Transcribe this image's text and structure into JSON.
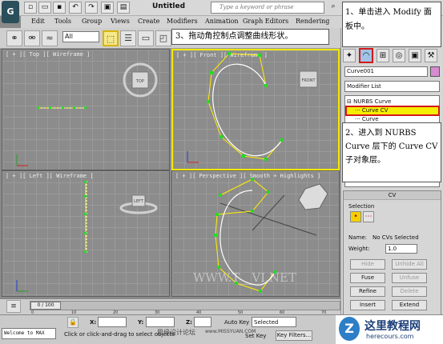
{
  "window": {
    "doc_title": "Untitled",
    "search_placeholder": "Type a keyword or phrase"
  },
  "menu": [
    "Edit",
    "Tools",
    "Group",
    "Views",
    "Create",
    "Modifiers",
    "Animation",
    "Graph Editors",
    "Rendering"
  ],
  "toolbar": {
    "selection_filter": "All"
  },
  "viewports": {
    "top_label": "[ + ][ Top ][ Wireframe ]",
    "front_label": "[ + ][ Front ][ Wireframe ]",
    "left_label": "[ + ][ Left ][ Wireframe ]",
    "perspective_label": "[ + ][ Perspective ][ Smooth + Highlights ]",
    "cube_top": "TOP",
    "cube_front": "FRONT",
    "cube_left": "LEFT"
  },
  "annotations": {
    "step1": "1、单击进入 Modify 面板中。",
    "step2": "2、进入到 NURBS Curve 层下的 Curve CV 子对象层。",
    "step3": "3、拖动角控制点调整曲线形状。"
  },
  "command_panel": {
    "object_name": "Curve001",
    "modifier_list": "Modifier List",
    "stack": {
      "nurbs": "NURBS Curve",
      "curve_cv": "Curve CV",
      "curve": "Curve"
    },
    "cv_rollout": {
      "title": "CV",
      "selection_label": "Selection",
      "name_label": "Name:",
      "name_value": "No CVs Selected",
      "weight_label": "Weight:",
      "weight_value": "1.0",
      "hide": "Hide",
      "unhide_all": "Unhide All",
      "fuse": "Fuse",
      "unfuse": "Unfuse",
      "refine": "Refine",
      "delete": "Delete",
      "insert": "Insert",
      "extend": "Extend"
    }
  },
  "timeline": {
    "frame_readout": "0 / 100",
    "ticks": [
      "0",
      "10",
      "20",
      "30",
      "40",
      "50",
      "60",
      "70"
    ]
  },
  "status": {
    "welcome": "Welcome to MAX",
    "prompt": "Click or click-and-drag to select objects",
    "x_label": "X:",
    "y_label": "Y:",
    "z_label": "Z:",
    "auto_key": "Auto Key",
    "selected": "Selected",
    "set_key": "Set Key",
    "key_filters": "Key Filters..."
  },
  "watermarks": {
    "site_cn": "这里教程网",
    "site_url": "herecours.com",
    "forum": "思缘设计论坛",
    "forum_url": "www.MISSYUAN.COM",
    "viewport_mark": "WWW.T__VI.NET"
  },
  "colors": {
    "active_viewport": "#f3e800",
    "curve": "#ffffff",
    "cv_lines": "#ffee00",
    "cv_points": "#22dd22",
    "highlight": "#d21818"
  }
}
